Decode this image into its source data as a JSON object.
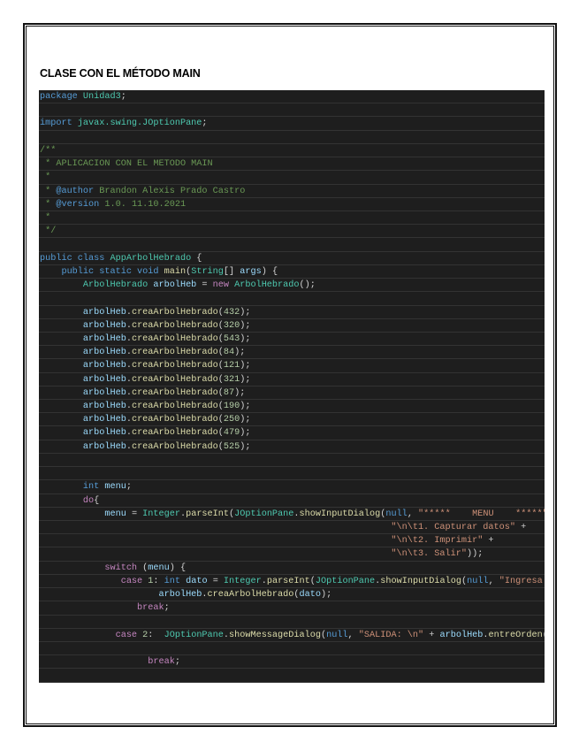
{
  "document": {
    "heading": "CLASE CON EL MÉTODO MAIN"
  },
  "code_lines": [
    [
      [
        "package ",
        "k"
      ],
      [
        "Unidad3",
        "t"
      ],
      [
        ";",
        "d"
      ]
    ],
    [],
    [
      [
        "import ",
        "k"
      ],
      [
        "javax.swing.JOptionPane",
        "t"
      ],
      [
        ";",
        "d"
      ]
    ],
    [],
    [
      [
        "/**",
        "c"
      ]
    ],
    [
      [
        " * APLICACION CON EL METODO MAIN",
        "c"
      ]
    ],
    [
      [
        " *",
        "c"
      ]
    ],
    [
      [
        " * ",
        "c"
      ],
      [
        "@author",
        "k"
      ],
      [
        " Brandon Alexis Prado Castro",
        "c"
      ]
    ],
    [
      [
        " * ",
        "c"
      ],
      [
        "@version",
        "k"
      ],
      [
        " 1.0. 11.10.2021",
        "c"
      ]
    ],
    [
      [
        " *",
        "c"
      ]
    ],
    [
      [
        " */",
        "c"
      ]
    ],
    [],
    [
      [
        "public class ",
        "k"
      ],
      [
        "AppArbolHebrado",
        "t"
      ],
      [
        " {",
        "d"
      ]
    ],
    [
      [
        "    public static void ",
        "k"
      ],
      [
        "main",
        "f"
      ],
      [
        "(",
        "d"
      ],
      [
        "String",
        "t"
      ],
      [
        "[] ",
        "d"
      ],
      [
        "args",
        "v"
      ],
      [
        ") {",
        "d"
      ]
    ],
    [
      [
        "        ArbolHebrado ",
        "t"
      ],
      [
        "arbolHeb",
        "v"
      ],
      [
        " = ",
        "d"
      ],
      [
        "new ",
        "p"
      ],
      [
        "ArbolHebrado",
        "t"
      ],
      [
        "();",
        "d"
      ]
    ],
    [],
    [
      [
        "        arbolHeb",
        "v"
      ],
      [
        ".",
        "d"
      ],
      [
        "creaArbolHebrado",
        "f"
      ],
      [
        "(",
        "d"
      ],
      [
        "432",
        "n"
      ],
      [
        ");",
        "d"
      ]
    ],
    [
      [
        "        arbolHeb",
        "v"
      ],
      [
        ".",
        "d"
      ],
      [
        "creaArbolHebrado",
        "f"
      ],
      [
        "(",
        "d"
      ],
      [
        "320",
        "n"
      ],
      [
        ");",
        "d"
      ]
    ],
    [
      [
        "        arbolHeb",
        "v"
      ],
      [
        ".",
        "d"
      ],
      [
        "creaArbolHebrado",
        "f"
      ],
      [
        "(",
        "d"
      ],
      [
        "543",
        "n"
      ],
      [
        ");",
        "d"
      ]
    ],
    [
      [
        "        arbolHeb",
        "v"
      ],
      [
        ".",
        "d"
      ],
      [
        "creaArbolHebrado",
        "f"
      ],
      [
        "(",
        "d"
      ],
      [
        "84",
        "n"
      ],
      [
        ");",
        "d"
      ]
    ],
    [
      [
        "        arbolHeb",
        "v"
      ],
      [
        ".",
        "d"
      ],
      [
        "creaArbolHebrado",
        "f"
      ],
      [
        "(",
        "d"
      ],
      [
        "121",
        "n"
      ],
      [
        ");",
        "d"
      ]
    ],
    [
      [
        "        arbolHeb",
        "v"
      ],
      [
        ".",
        "d"
      ],
      [
        "creaArbolHebrado",
        "f"
      ],
      [
        "(",
        "d"
      ],
      [
        "321",
        "n"
      ],
      [
        ");",
        "d"
      ]
    ],
    [
      [
        "        arbolHeb",
        "v"
      ],
      [
        ".",
        "d"
      ],
      [
        "creaArbolHebrado",
        "f"
      ],
      [
        "(",
        "d"
      ],
      [
        "87",
        "n"
      ],
      [
        ");",
        "d"
      ]
    ],
    [
      [
        "        arbolHeb",
        "v"
      ],
      [
        ".",
        "d"
      ],
      [
        "creaArbolHebrado",
        "f"
      ],
      [
        "(",
        "d"
      ],
      [
        "190",
        "n"
      ],
      [
        ");",
        "d"
      ]
    ],
    [
      [
        "        arbolHeb",
        "v"
      ],
      [
        ".",
        "d"
      ],
      [
        "creaArbolHebrado",
        "f"
      ],
      [
        "(",
        "d"
      ],
      [
        "250",
        "n"
      ],
      [
        ");",
        "d"
      ]
    ],
    [
      [
        "        arbolHeb",
        "v"
      ],
      [
        ".",
        "d"
      ],
      [
        "creaArbolHebrado",
        "f"
      ],
      [
        "(",
        "d"
      ],
      [
        "479",
        "n"
      ],
      [
        ");",
        "d"
      ]
    ],
    [
      [
        "        arbolHeb",
        "v"
      ],
      [
        ".",
        "d"
      ],
      [
        "creaArbolHebrado",
        "f"
      ],
      [
        "(",
        "d"
      ],
      [
        "525",
        "n"
      ],
      [
        ");",
        "d"
      ]
    ],
    [],
    [],
    [
      [
        "        int ",
        "k"
      ],
      [
        "menu",
        "v"
      ],
      [
        ";",
        "d"
      ]
    ],
    [
      [
        "        do",
        "p"
      ],
      [
        "{",
        "d"
      ]
    ],
    [
      [
        "            menu",
        "v"
      ],
      [
        " = ",
        "d"
      ],
      [
        "Integer",
        "t"
      ],
      [
        ".",
        "d"
      ],
      [
        "parseInt",
        "f"
      ],
      [
        "(",
        "d"
      ],
      [
        "JOptionPane",
        "t"
      ],
      [
        ".",
        "d"
      ],
      [
        "showInputDialog",
        "f"
      ],
      [
        "(",
        "d"
      ],
      [
        "null",
        "k"
      ],
      [
        ", ",
        "d"
      ],
      [
        "\"*****    MENU    *****\"",
        "s"
      ],
      [
        " +",
        "d"
      ]
    ],
    [
      [
        "                                                                 \"\\n\\t1. Capturar datos\"",
        "s"
      ],
      [
        " +",
        "d"
      ]
    ],
    [
      [
        "                                                                 \"\\n\\t2. Imprimir\"",
        "s"
      ],
      [
        " +",
        "d"
      ]
    ],
    [
      [
        "                                                                 \"\\n\\t3. Salir\"",
        "s"
      ],
      [
        "));",
        "d"
      ]
    ],
    [
      [
        "            switch",
        "p"
      ],
      [
        " (",
        "d"
      ],
      [
        "menu",
        "v"
      ],
      [
        ") {",
        "d"
      ]
    ],
    [
      [
        "               case ",
        "p"
      ],
      [
        "1",
        "n"
      ],
      [
        ": ",
        "d"
      ],
      [
        "int ",
        "k"
      ],
      [
        "dato",
        "v"
      ],
      [
        " = ",
        "d"
      ],
      [
        "Integer",
        "t"
      ],
      [
        ".",
        "d"
      ],
      [
        "parseInt",
        "f"
      ],
      [
        "(",
        "d"
      ],
      [
        "JOptionPane",
        "t"
      ],
      [
        ".",
        "d"
      ],
      [
        "showInputDialog",
        "f"
      ],
      [
        "(",
        "d"
      ],
      [
        "null",
        "k"
      ],
      [
        ", ",
        "d"
      ],
      [
        "\"Ingresa el dato\"",
        "s"
      ],
      [
        "));",
        "d"
      ]
    ],
    [
      [
        "                      arbolHeb",
        "v"
      ],
      [
        ".",
        "d"
      ],
      [
        "creaArbolHebrado",
        "f"
      ],
      [
        "(",
        "d"
      ],
      [
        "dato",
        "v"
      ],
      [
        ");",
        "d"
      ]
    ],
    [
      [
        "                  break",
        "p"
      ],
      [
        ";",
        "d"
      ]
    ],
    [],
    [
      [
        "              case ",
        "p"
      ],
      [
        "2",
        "n"
      ],
      [
        ":  ",
        "d"
      ],
      [
        "JOptionPane",
        "t"
      ],
      [
        ".",
        "d"
      ],
      [
        "showMessageDialog",
        "f"
      ],
      [
        "(",
        "d"
      ],
      [
        "null",
        "k"
      ],
      [
        ", ",
        "d"
      ],
      [
        "\"SALIDA: \\n\"",
        "s"
      ],
      [
        " + ",
        "d"
      ],
      [
        "arbolHeb",
        "v"
      ],
      [
        ".",
        "d"
      ],
      [
        "entreOrden",
        "f"
      ],
      [
        "());",
        "d"
      ]
    ],
    [],
    [
      [
        "                    break",
        "p"
      ],
      [
        ";",
        "d"
      ]
    ],
    []
  ]
}
